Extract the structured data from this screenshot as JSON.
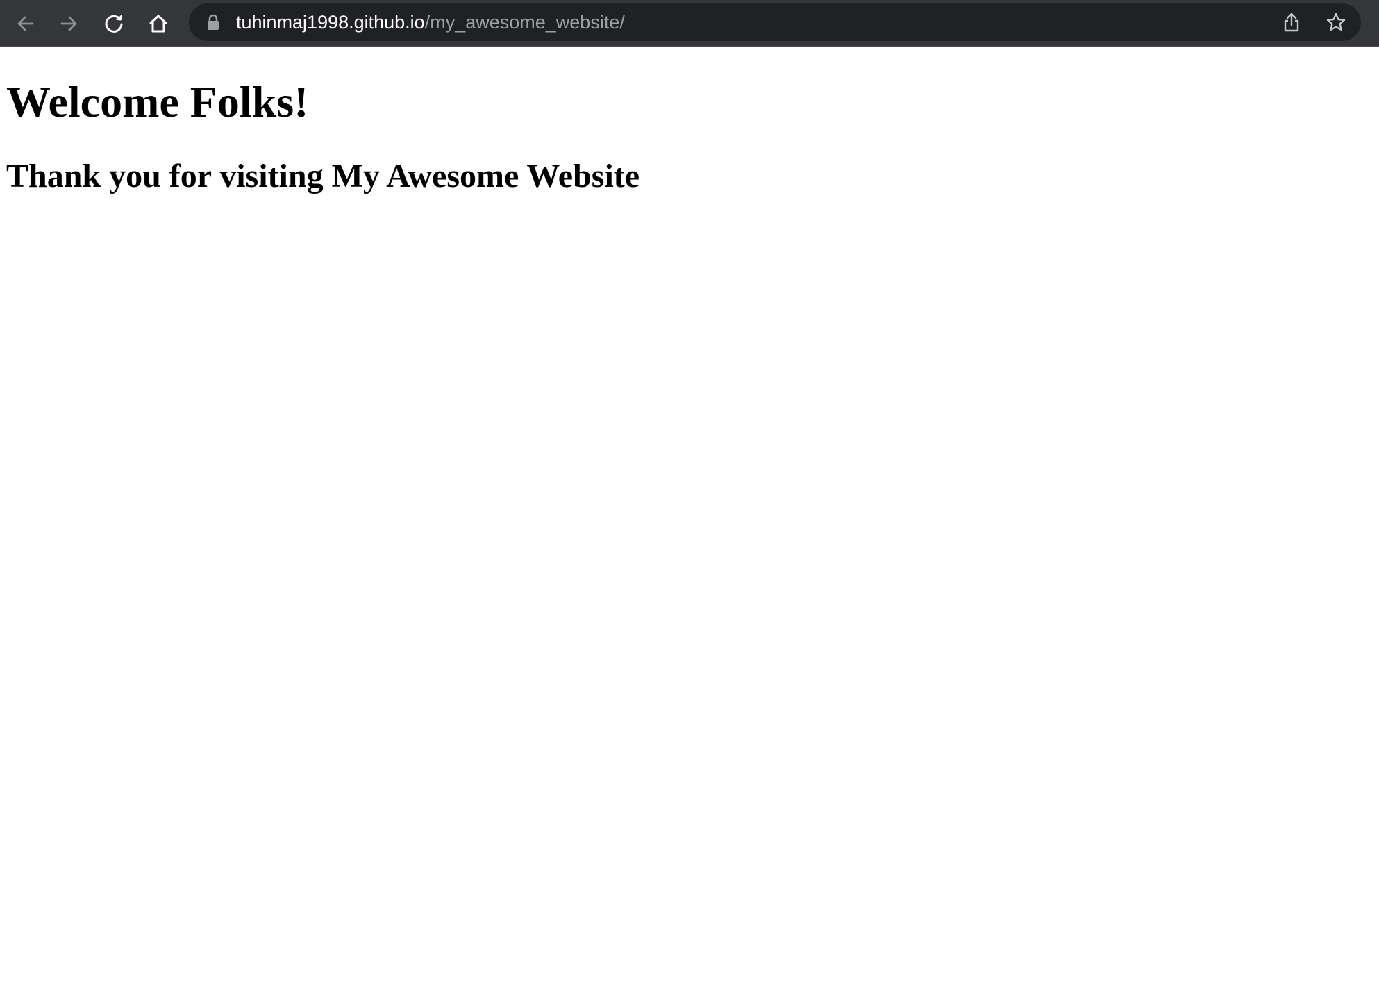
{
  "browser": {
    "url_host": "tuhinmaj1998.github.io",
    "url_path": "/my_awesome_website/",
    "icons": {
      "back": "arrow-left-icon",
      "forward": "arrow-right-icon",
      "reload": "reload-icon",
      "home": "home-icon",
      "lock": "lock-icon",
      "share": "share-icon",
      "bookmark": "star-icon"
    },
    "colors": {
      "toolbar": "#35363a",
      "omnibox": "#202124",
      "url_host": "#ffffff",
      "url_path": "#9aa0a6"
    }
  },
  "page": {
    "heading": "Welcome Folks!",
    "subheading": "Thank you for visiting My Awesome Website"
  }
}
